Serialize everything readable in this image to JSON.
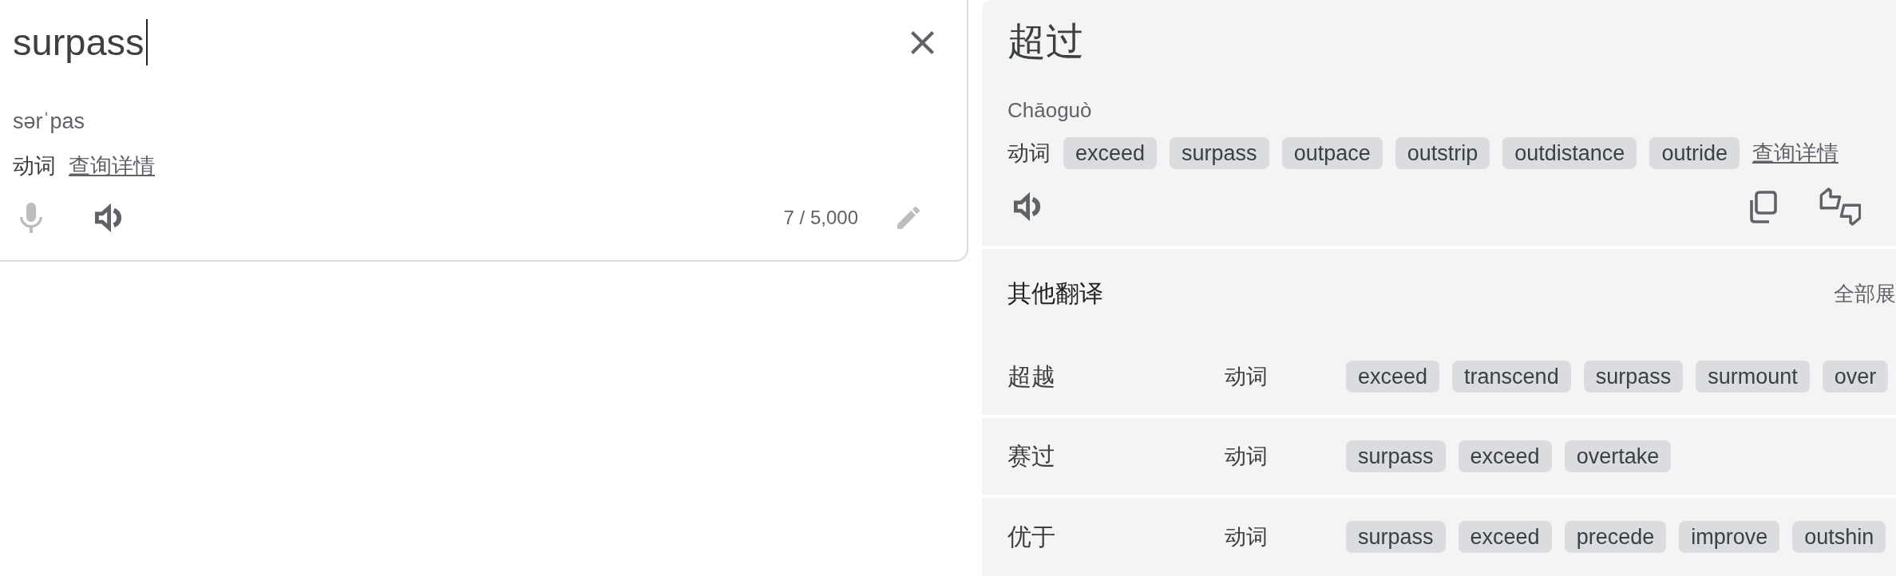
{
  "source": {
    "text": "surpass",
    "focused": true,
    "phonetic": "sərˈpas",
    "part_of_speech": "动词",
    "details_link": "查询详情",
    "char_count": "7 / 5,000",
    "mic": {
      "disabled": true
    },
    "edit": {
      "disabled": true
    }
  },
  "translation": {
    "text": "超过",
    "romanization": "Chāoguò",
    "part_of_speech": "动词",
    "synonyms": [
      "exceed",
      "surpass",
      "outpace",
      "outstrip",
      "outdistance",
      "outride"
    ],
    "details_link": "查询详情"
  },
  "other_translations": {
    "title": "其他翻译",
    "expand_link": "全部展",
    "rows": [
      {
        "word": "超越",
        "part_of_speech": "动词",
        "synonyms": [
          "exceed",
          "transcend",
          "surpass",
          "surmount",
          "over"
        ]
      },
      {
        "word": "赛过",
        "part_of_speech": "动词",
        "synonyms": [
          "surpass",
          "exceed",
          "overtake"
        ]
      },
      {
        "word": "优于",
        "part_of_speech": "动词",
        "synonyms": [
          "surpass",
          "exceed",
          "precede",
          "improve",
          "outshin"
        ]
      }
    ]
  }
}
